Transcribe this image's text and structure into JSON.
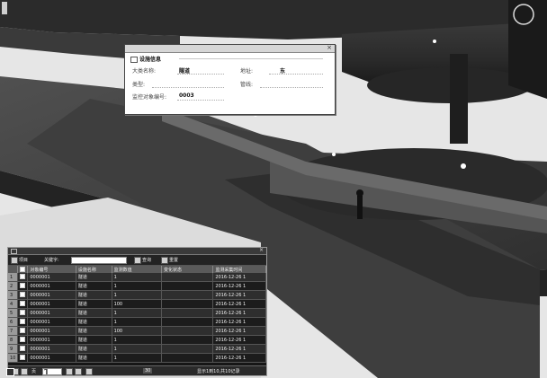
{
  "scene": {},
  "info_popup": {
    "section_title": "设施信息",
    "fields": [
      {
        "label": "大类名称:",
        "value": "隧道"
      },
      {
        "label": "地址:",
        "value": "东"
      },
      {
        "label": "类型:",
        "value": ""
      },
      {
        "label": "管线:",
        "value": ""
      },
      {
        "label": "监控对象编号:",
        "value": "0003"
      }
    ]
  },
  "data_panel": {
    "toolbar": {
      "items_label": "项目",
      "search_label": "关键字:",
      "search_value": "",
      "search_button": "查询",
      "reset_button": "重置"
    },
    "columns": [
      "",
      "",
      "对象编号",
      "设施名称",
      "监测数值",
      "变化状态",
      "监测采集时间"
    ],
    "rows": [
      [
        "1",
        "0000001",
        "隧道",
        "1",
        "",
        "2016-12-26 1"
      ],
      [
        "2",
        "0000001",
        "隧道",
        "1",
        "",
        "2016-12-26 1"
      ],
      [
        "3",
        "0000001",
        "隧道",
        "1",
        "",
        "2016-12-26 1"
      ],
      [
        "4",
        "0000001",
        "隧道",
        "100",
        "",
        "2016-12-26 1"
      ],
      [
        "5",
        "0000001",
        "隧道",
        "1",
        "",
        "2016-12-26 1"
      ],
      [
        "6",
        "0000001",
        "隧道",
        "1",
        "",
        "2016-12-26 1"
      ],
      [
        "7",
        "0000001",
        "隧道",
        "100",
        "",
        "2016-12-26 1"
      ],
      [
        "8",
        "0000001",
        "隧道",
        "1",
        "",
        "2016-12-26 1"
      ],
      [
        "9",
        "0000001",
        "隧道",
        "1",
        "",
        "2016-12-26 1"
      ],
      [
        "10",
        "0000001",
        "隧道",
        "1",
        "",
        "2016-12-26 1"
      ]
    ],
    "pager": {
      "page_label": "页",
      "page_value": "1",
      "size_value": "30",
      "summary": "显示1到10,共10记录"
    }
  }
}
